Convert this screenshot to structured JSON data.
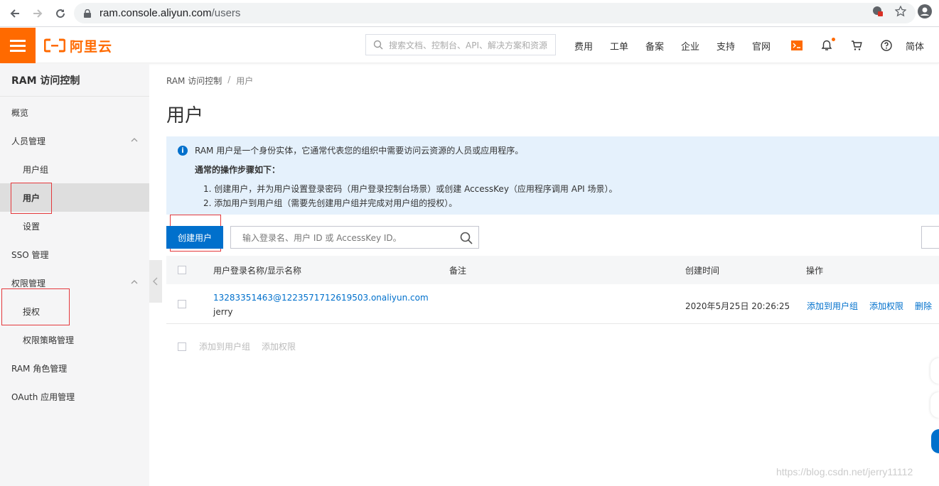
{
  "browser": {
    "url_host": "ram.console.aliyun.com",
    "url_path": "/users"
  },
  "topnav": {
    "logo_text": "阿里云",
    "search_placeholder": "搜索文档、控制台、API、解决方案和资源",
    "links": [
      "费用",
      "工单",
      "备案",
      "企业",
      "支持",
      "官网"
    ],
    "language": "简体"
  },
  "sidebar": {
    "title": "RAM 访问控制",
    "items": [
      {
        "label": "概览"
      },
      {
        "label": "人员管理"
      },
      {
        "label": "用户组"
      },
      {
        "label": "用户"
      },
      {
        "label": "设置"
      },
      {
        "label": "SSO 管理"
      },
      {
        "label": "权限管理"
      },
      {
        "label": "授权"
      },
      {
        "label": "权限策略管理"
      },
      {
        "label": "RAM 角色管理"
      },
      {
        "label": "OAuth 应用管理"
      }
    ]
  },
  "breadcrumb": {
    "root": "RAM 访问控制",
    "sep": "/",
    "current": "用户"
  },
  "page": {
    "title": "用户"
  },
  "notice": {
    "line1": "RAM 用户是一个身份实体，它通常代表您的组织中需要访问云资源的人员或应用程序。",
    "heading": "通常的操作步骤如下：",
    "step1": "1. 创建用户，并为用户设置登录密码（用户登录控制台场景）或创建 AccessKey（应用程序调用 API 场景）。",
    "step2": "2. 添加用户到用户组（需要先创建用户组并完成对用户组的授权）。"
  },
  "toolbar": {
    "create_button": "创建用户",
    "search_placeholder": "输入登录名、用户 ID 或 AccessKey ID。"
  },
  "table": {
    "headers": {
      "name": "用户登录名称/显示名称",
      "note": "备注",
      "created": "创建时间",
      "actions": "操作"
    },
    "rows": [
      {
        "login": "13283351463@1223571712619503.onaliyun.com",
        "display": "jerry",
        "note": "",
        "created": "2020年5月25日 20:26:25",
        "action_add_group": "添加到用户组",
        "action_add_perm": "添加权限",
        "action_delete": "删除"
      }
    ]
  },
  "batch_actions": {
    "add_group": "添加到用户组",
    "add_perm": "添加权限"
  },
  "watermark": "https://blog.csdn.net/jerry11112",
  "colors": {
    "accent": "#ff6a00",
    "primary": "#0070cc",
    "highlight": "#e4393c"
  }
}
